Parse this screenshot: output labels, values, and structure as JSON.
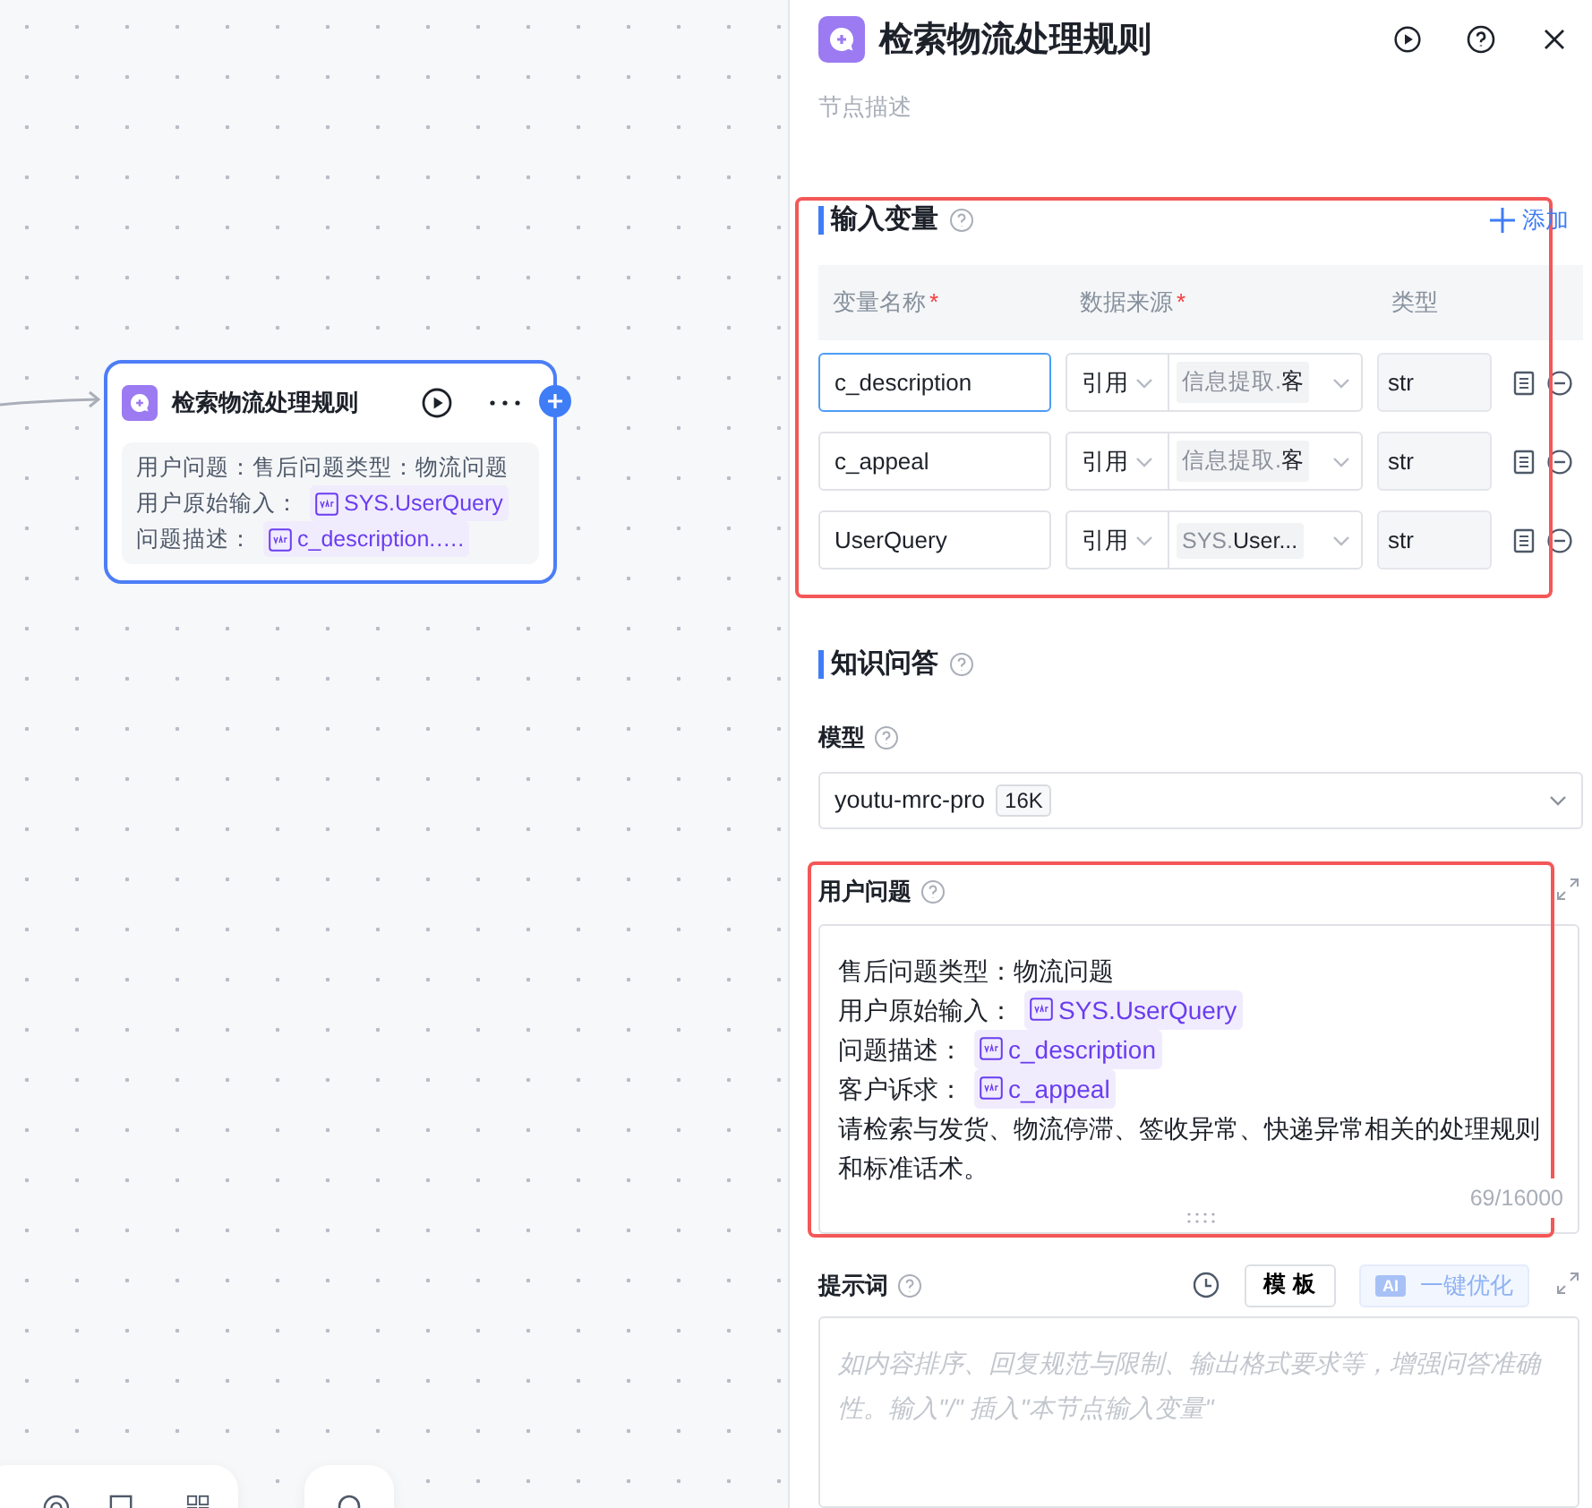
{
  "node": {
    "title": "检索物流处理规则",
    "lines": [
      {
        "label": "用户问题：",
        "text": "售后问题类型：物流问题"
      },
      {
        "label": "用户原始输入：",
        "var": "SYS.UserQuery"
      },
      {
        "label": "问题描述：",
        "var": "c_description.…."
      }
    ]
  },
  "panel": {
    "title": "检索物流处理规则",
    "description_placeholder": "节点描述",
    "input_section": {
      "title": "输入变量",
      "add_label": "添加",
      "required_mark": "*",
      "columns": [
        {
          "label": "变量名称",
          "required": true
        },
        {
          "label": "数据来源",
          "required": true
        },
        {
          "label": "类型",
          "required": false
        }
      ],
      "rows": [
        {
          "name": "c_description",
          "focused": true,
          "source": "引用",
          "ref_prefix": "信息提取.",
          "ref_name": "客",
          "type": "str"
        },
        {
          "name": "c_appeal",
          "focused": false,
          "source": "引用",
          "ref_prefix": "信息提取.",
          "ref_name": "客",
          "type": "str"
        },
        {
          "name": "UserQuery",
          "focused": false,
          "source": "引用",
          "ref_prefix": "SYS.",
          "ref_name": "User...",
          "type": "str"
        }
      ]
    },
    "knowledge_section": {
      "title": "知识问答",
      "model_label": "模型",
      "model": "youtu-mrc-pro",
      "model_badge": "16K",
      "question_label": "用户问题",
      "question_lines": [
        {
          "text": "售后问题类型：物流问题"
        },
        {
          "text": "用户原始输入：",
          "var": "SYS.UserQuery"
        },
        {
          "text": "问题描述：",
          "var": "c_description"
        },
        {
          "text": "客户诉求：",
          "var": "c_appeal"
        },
        {
          "text": "请检索与发货、物流停滞、签收异常、快递异常相关的处理规则和标准话术。"
        }
      ],
      "counter": "69/16000",
      "prompt_label": "提示词",
      "template_button": "模 板",
      "ai_badge": "AI",
      "optimize_button": "一键优化",
      "prompt_placeholder": "如内容排序、回复规范与限制、输出格式要求等，增强问答准确性。输入\"/\" 插入\"本节点输入变量\""
    }
  }
}
